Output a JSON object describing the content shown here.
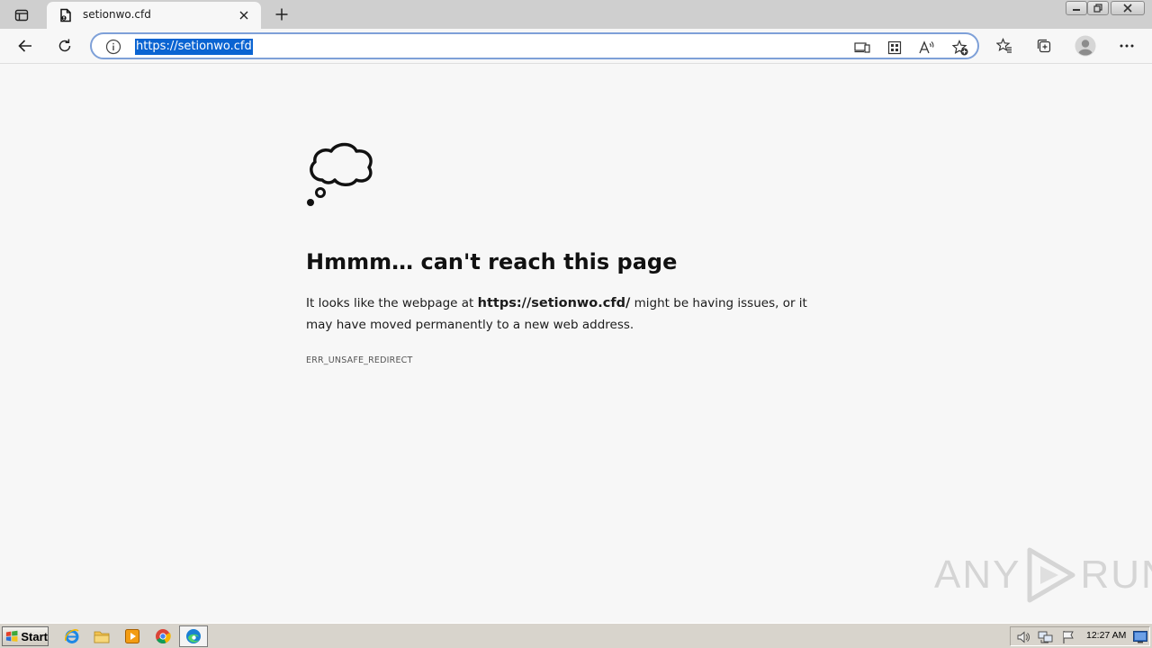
{
  "browser": {
    "tab": {
      "title": "setionwo.cfd"
    },
    "address": {
      "url": "https://setionwo.cfd"
    }
  },
  "error": {
    "heading": "Hmmm… can't reach this page",
    "text_before": "It looks like the webpage at ",
    "url": "https://setionwo.cfd/",
    "text_after": " might be having issues, or it may have moved permanently to a new web address.",
    "code": "ERR_UNSAFE_REDIRECT"
  },
  "watermark": {
    "left": "ANY",
    "right": "RUN"
  },
  "taskbar": {
    "start_label": "Start",
    "clock": "12:27 AM"
  },
  "colors": {
    "accent": "#0a64d2",
    "address_border": "#7ea0d8",
    "page_bg": "#f7f7f7",
    "tabstrip_bg": "#cfcfcf"
  },
  "icons": {
    "tab_actions": "tab-actions-icon",
    "favicon": "page-file-icon",
    "tab_close": "close-icon",
    "new_tab": "plus-icon",
    "back": "arrow-left-icon",
    "refresh": "refresh-icon",
    "site_info": "info-icon",
    "app_available": "app-available-icon",
    "extensions": "grid-icon",
    "read_aloud": "read-aloud-icon",
    "add_favorite": "star-plus-icon",
    "favorites": "favorites-icon",
    "collections": "collections-icon",
    "profile": "avatar-icon",
    "more": "more-icon",
    "error_illustration": "thought-cloud-icon"
  }
}
